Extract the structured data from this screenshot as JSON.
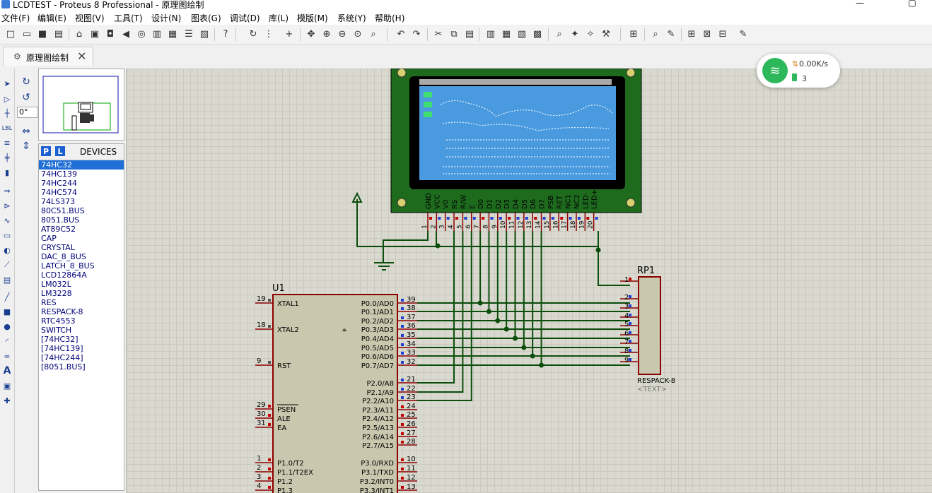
{
  "window": {
    "title": "LCDTEST - Proteus 8 Professional - 原理图绘制",
    "minimize_glyph": "—",
    "maximize_glyph": "▢"
  },
  "menu": [
    "文件(F)",
    "编辑(E)",
    "视图(V)",
    "工具(T)",
    "设计(N)",
    "图表(G)",
    "调试(D)",
    "库(L)",
    "模版(M)",
    "系统(Y)",
    "帮助(H)"
  ],
  "toolbar": {
    "icons": [
      "new-icon",
      "open-icon",
      "save-icon",
      "import-icon",
      "home-icon",
      "component-icon",
      "chip-icon",
      "back-icon",
      "pcb-icon",
      "netlist-icon",
      "bom-icon",
      "design-explorer-icon",
      "report-icon",
      "help-icon",
      "refresh-icon",
      "grid-icon",
      "origin-icon",
      "pan-icon",
      "zoom-in-icon",
      "zoom-out-icon",
      "zoom-all-icon",
      "zoom-area-icon",
      "undo-icon",
      "redo-icon",
      "cut-icon",
      "copy-icon",
      "paste-icon",
      "block-copy-icon",
      "block-move-icon",
      "block-rotate-icon",
      "block-delete-icon",
      "pick-device-icon",
      "make-device-icon",
      "packaging-icon",
      "decompose-icon",
      "wire-autorouter-icon",
      "search-icon",
      "property-tool-icon",
      "new-sheet-icon",
      "delete-sheet-icon",
      "sheet-exit-icon"
    ]
  },
  "tab": {
    "label": "原理图绘制",
    "close": "✕"
  },
  "rotation": {
    "angle": "0°"
  },
  "devices": {
    "title": "DEVICES",
    "p_label": "P",
    "l_label": "L",
    "items": [
      "74HC32",
      "74HC139",
      "74HC244",
      "74HC574",
      "74LS373",
      "80C51.BUS",
      "8051.BUS",
      "AT89C52",
      "CAP",
      "CRYSTAL",
      "DAC_8_BUS",
      "LATCH_8_BUS",
      "LCD12864A",
      "LM032L",
      "LM3228",
      "RES",
      "RESPACK-8",
      "RTC4553",
      "SWITCH",
      "[74HC32]",
      "[74HC139]",
      "[74HC244]",
      "[8051.BUS]"
    ],
    "selected": "74HC32"
  },
  "network": {
    "speed": "0.00K/s",
    "count": "3"
  },
  "schematic": {
    "u1": {
      "ref": "U1",
      "left_pins": [
        {
          "num": "19",
          "name": "XTAL1"
        },
        {
          "num": "18",
          "name": "XTAL2"
        },
        {
          "num": "9",
          "name": "RST"
        },
        {
          "num": "29",
          "name": "PSEN"
        },
        {
          "num": "30",
          "name": "ALE"
        },
        {
          "num": "31",
          "name": "EA"
        },
        {
          "num": "1",
          "name": "P1.0/T2"
        },
        {
          "num": "2",
          "name": "P1.1/T2EX"
        },
        {
          "num": "3",
          "name": "P1.2"
        },
        {
          "num": "4",
          "name": "P1.3"
        }
      ],
      "right_pins": [
        {
          "num": "39",
          "name": "P0.0/AD0"
        },
        {
          "num": "38",
          "name": "P0.1/AD1"
        },
        {
          "num": "37",
          "name": "P0.2/AD2"
        },
        {
          "num": "36",
          "name": "P0.3/AD3"
        },
        {
          "num": "35",
          "name": "P0.4/AD4"
        },
        {
          "num": "34",
          "name": "P0.5/AD5"
        },
        {
          "num": "33",
          "name": "P0.6/AD6"
        },
        {
          "num": "32",
          "name": "P0.7/AD7"
        },
        {
          "num": "21",
          "name": "P2.0/A8"
        },
        {
          "num": "22",
          "name": "P2.1/A9"
        },
        {
          "num": "23",
          "name": "P2.2/A10"
        },
        {
          "num": "24",
          "name": "P2.3/A11"
        },
        {
          "num": "25",
          "name": "P2.4/A12"
        },
        {
          "num": "26",
          "name": "P2.5/A13"
        },
        {
          "num": "27",
          "name": "P2.6/A14"
        },
        {
          "num": "28",
          "name": "P2.7/A15"
        },
        {
          "num": "10",
          "name": "P3.0/RXD"
        },
        {
          "num": "11",
          "name": "P3.1/TXD"
        },
        {
          "num": "12",
          "name": "P3.2/INT0"
        },
        {
          "num": "13",
          "name": "P3.3/INT1"
        }
      ]
    },
    "lcd": {
      "pins": [
        "GND",
        "VCC",
        "V0",
        "RS",
        "R/W",
        "E",
        "D0",
        "D1",
        "D2",
        "D3",
        "D4",
        "D5",
        "D6",
        "D7",
        "PSB",
        "RET",
        "NC1",
        "NC2",
        "LED-",
        "LED+"
      ],
      "pin_numbers": [
        "1",
        "2",
        "3",
        "4",
        "5",
        "6",
        "7",
        "8",
        "9",
        "10",
        "11",
        "12",
        "13",
        "14",
        "15",
        "16",
        "17",
        "18",
        "19",
        "20"
      ]
    },
    "rp1": {
      "ref": "RP1",
      "part": "RESPACK-8",
      "text": "<TEXT>",
      "pins": [
        "1",
        "2",
        "3",
        "4",
        "5",
        "6",
        "7",
        "8",
        "9"
      ]
    }
  }
}
